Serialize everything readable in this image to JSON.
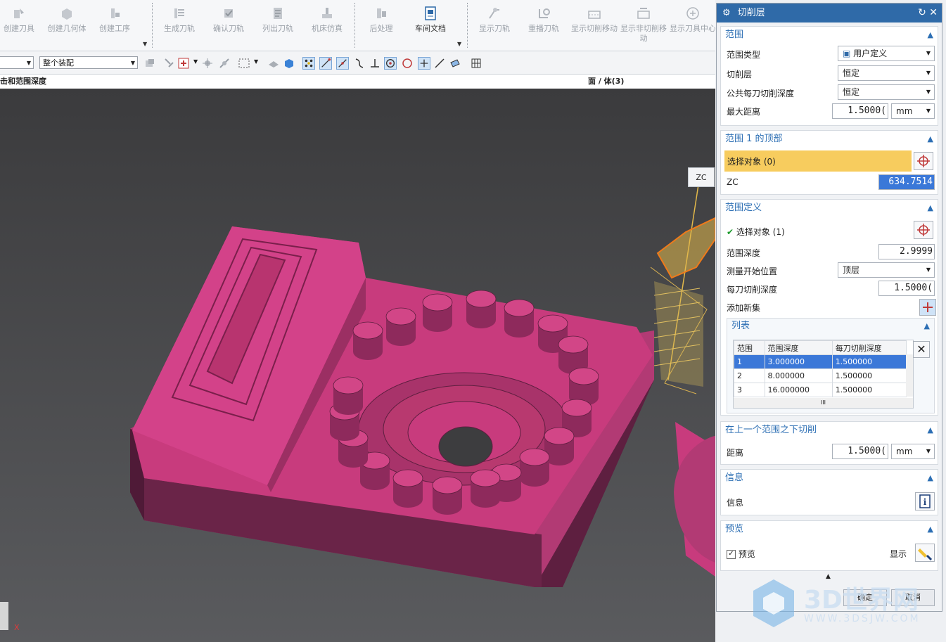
{
  "ribbon": {
    "buttons": [
      {
        "label": "创建刀具",
        "icon": "create-tool-icon"
      },
      {
        "label": "创建几何体",
        "icon": "create-geometry-icon"
      },
      {
        "label": "创建工序",
        "icon": "create-operation-icon"
      },
      {
        "label": "生成刀轨",
        "icon": "generate-path-icon"
      },
      {
        "label": "确认刀轨",
        "icon": "verify-path-icon"
      },
      {
        "label": "列出刀轨",
        "icon": "list-path-icon"
      },
      {
        "label": "机床仿真",
        "icon": "machine-sim-icon"
      },
      {
        "label": "后处理",
        "icon": "postprocess-icon"
      },
      {
        "label": "车间文档",
        "icon": "shop-doc-icon"
      },
      {
        "label": "显示刀轨",
        "icon": "display-path-icon"
      },
      {
        "label": "重播刀轨",
        "icon": "replay-path-icon"
      },
      {
        "label": "显示切削移动",
        "icon": "show-cut-moves-icon"
      },
      {
        "label": "显示非切削移动",
        "icon": "show-noncut-moves-icon"
      },
      {
        "label": "显示刀具中心",
        "icon": "show-tool-center-icon"
      }
    ]
  },
  "toolbar": {
    "assembly_combo": "整个装配"
  },
  "status": {
    "left": "击和范围深度",
    "right": "面 / 体(3)"
  },
  "viewport": {
    "zc_label": "ZC",
    "axis_label": "X"
  },
  "dialog": {
    "title": "切削层",
    "range": {
      "header": "范围",
      "range_type_label": "范围类型",
      "range_type_value": "用户定义",
      "cut_levels_label": "切削层",
      "cut_levels_value": "恒定",
      "common_depth_label": "公共每刀切削深度",
      "common_depth_value": "恒定",
      "max_distance_label": "最大距离",
      "max_distance_value": "1.5000(",
      "max_distance_unit": "mm"
    },
    "top": {
      "header": "范围 1 的顶部",
      "select_label": "选择对象 (0)",
      "zc_label": "ZC",
      "zc_value": "634.7514"
    },
    "definition": {
      "header": "范围定义",
      "select_label": "选择对象 (1)",
      "depth_label": "范围深度",
      "depth_value": "2.9999",
      "measure_label": "测量开始位置",
      "measure_value": "顶层",
      "per_cut_label": "每刀切削深度",
      "per_cut_value": "1.5000(",
      "add_set_label": "添加新集",
      "list": {
        "header": "列表",
        "columns": [
          "范围",
          "范围深度",
          "每刀切削深度"
        ],
        "rows": [
          [
            "1",
            "3.000000",
            "1.500000"
          ],
          [
            "2",
            "8.000000",
            "1.500000"
          ],
          [
            "3",
            "16.000000",
            "1.500000"
          ]
        ],
        "scroll_mark": "III"
      }
    },
    "below": {
      "header": "在上一个范围之下切削",
      "distance_label": "距离",
      "distance_value": "1.5000(",
      "distance_unit": "mm"
    },
    "info": {
      "header": "信息",
      "label": "信息"
    },
    "preview": {
      "header": "预览",
      "checkbox_label": "预览",
      "show_label": "显示"
    },
    "ok_label": "确定",
    "cancel_label": "取消"
  },
  "watermark": {
    "brand": "3D世界网",
    "url": "WWW.3DSJW.COM"
  },
  "colors": {
    "part": "#c83b7d",
    "title_bar": "#2f6aa8",
    "selection_row": "#f7cc5e",
    "section_header": "#2d6fb4"
  }
}
